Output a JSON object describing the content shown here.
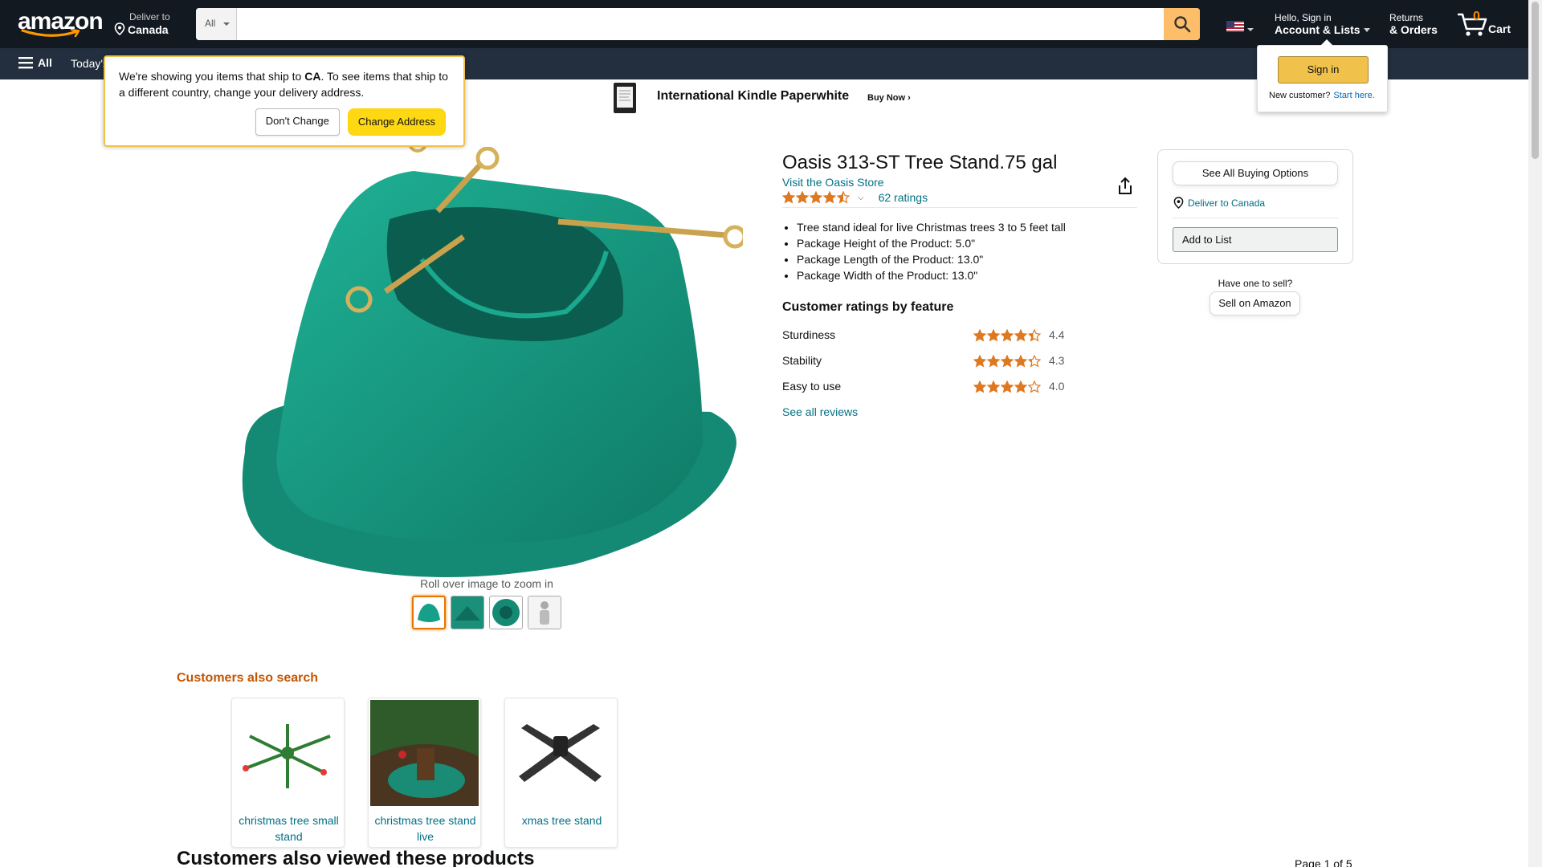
{
  "nav": {
    "logo_text": "amazon",
    "deliver_line1": "Deliver to",
    "deliver_line2": "Canada",
    "search_category": "All",
    "search_placeholder": "",
    "search_icon": "search-icon",
    "account_line1": "Hello, Sign in",
    "account_line2": "Account & Lists",
    "returns_line1": "Returns",
    "returns_line2": "& Orders",
    "cart_count": "0",
    "cart_label": "Cart",
    "all_label": "All",
    "todays_deals": "Today's"
  },
  "banner": {
    "title": "International Kindle Paperwhite",
    "cta": "Buy Now ›"
  },
  "popover": {
    "msg_part1": "We're showing you items that ship to ",
    "msg_country": "CA",
    "msg_part2": ". To see items that ship to a different country, change your delivery address.",
    "dont_change": "Don't Change",
    "change_address": "Change Address"
  },
  "flyout": {
    "signin": "Sign in",
    "new_customer": "New customer?",
    "start_here": "Start here."
  },
  "product": {
    "title": "Oasis 313-ST Tree Stand.75 gal",
    "store_link": "Visit the Oasis Store",
    "rating": 4.5,
    "ratings_count": "62 ratings",
    "bullets": [
      "Tree stand ideal for live Christmas trees 3 to 5 feet tall",
      "Package Height of the Product: 5.0\"",
      "Package Length of the Product: 13.0\"",
      "Package Width of the Product: 13.0\""
    ],
    "zoom_hint": "Roll over image to zoom in",
    "thumbnail_count": 4,
    "selected_thumbnail": 0
  },
  "features": {
    "title": "Customer ratings by feature",
    "items": [
      {
        "name": "Sturdiness",
        "value": "4.4"
      },
      {
        "name": "Stability",
        "value": "4.3"
      },
      {
        "name": "Easy to use",
        "value": "4.0"
      }
    ],
    "see_all": "See all reviews"
  },
  "buybox": {
    "see_all_options": "See All Buying Options",
    "deliver_to": "Deliver to Canada",
    "add_to_list": "Add to List",
    "have_one": "Have one to sell?",
    "sell_on": "Sell on Amazon"
  },
  "also_search": {
    "title": "Customers also search",
    "items": [
      {
        "label": "christmas tree small stand"
      },
      {
        "label": "christmas tree stand live"
      },
      {
        "label": "xmas tree stand"
      }
    ]
  },
  "also_viewed": {
    "title": "Customers also viewed these products",
    "page": "Page 1 of 5"
  },
  "colors": {
    "nav_dark": "#131921",
    "nav_secondary": "#232f3e",
    "search_button": "#febd69",
    "link": "#007185",
    "star": "#de7921",
    "product_green": "#1a9e86"
  }
}
